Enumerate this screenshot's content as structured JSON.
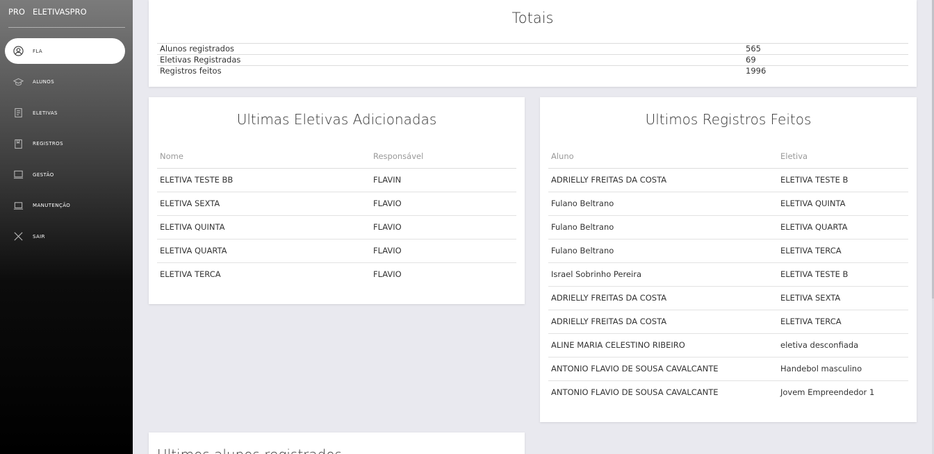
{
  "sidebar": {
    "brand_mini": "PRO",
    "brand_name": "ELETIVASPRO",
    "items": [
      {
        "label": "FLA",
        "icon": "user-circle-icon",
        "active": true
      },
      {
        "label": "ALUNOS",
        "icon": "graduation-cap-icon"
      },
      {
        "label": "ELETIVAS",
        "icon": "document-icon"
      },
      {
        "label": "REGISTROS",
        "icon": "notebook-icon"
      },
      {
        "label": "GESTÃO",
        "icon": "monitor-icon"
      },
      {
        "label": "MANUTENÇÃO",
        "icon": "laptop-icon"
      },
      {
        "label": "SAIR",
        "icon": "close-icon"
      }
    ]
  },
  "totais": {
    "title": "Totais",
    "rows": [
      {
        "label": "Alunos registrados",
        "value": "565"
      },
      {
        "label": "Eletivas Registradas",
        "value": "69"
      },
      {
        "label": "Registros feitos",
        "value": "1996"
      }
    ]
  },
  "eletivas": {
    "title": "Ultimas Eletivas Adicionadas",
    "headers": [
      "Nome",
      "Responsável"
    ],
    "rows": [
      [
        "ELETIVA TESTE BB",
        "FLAVIN"
      ],
      [
        "ELETIVA SEXTA",
        "FLAVIO"
      ],
      [
        "ELETIVA QUINTA",
        "FLAVIO"
      ],
      [
        "ELETIVA QUARTA",
        "FLAVIO"
      ],
      [
        "ELETIVA TERCA",
        "FLAVIO"
      ]
    ]
  },
  "registros": {
    "title": "Ultimos Registros Feitos",
    "headers": [
      "Aluno",
      "Eletiva"
    ],
    "rows": [
      [
        "ADRIELLY FREITAS DA COSTA",
        "ELETIVA TESTE B"
      ],
      [
        "Fulano Beltrano",
        "ELETIVA QUINTA"
      ],
      [
        "Fulano Beltrano",
        "ELETIVA QUARTA"
      ],
      [
        "Fulano Beltrano",
        "ELETIVA TERCA"
      ],
      [
        "Israel Sobrinho Pereira",
        "ELETIVA TESTE B"
      ],
      [
        "ADRIELLY FREITAS DA COSTA",
        "ELETIVA SEXTA"
      ],
      [
        "ADRIELLY FREITAS DA COSTA",
        "ELETIVA TERCA"
      ],
      [
        "ALINE MARIA CELESTINO RIBEIRO",
        "eletiva desconfiada"
      ],
      [
        "ANTONIO FLAVIO DE SOUSA CAVALCANTE",
        "Handebol masculino"
      ],
      [
        "ANTONIO FLAVIO DE SOUSA CAVALCANTE",
        "Jovem Empreendedor 1"
      ]
    ]
  },
  "alunos": {
    "title": "Ultimos alunos registrados"
  }
}
